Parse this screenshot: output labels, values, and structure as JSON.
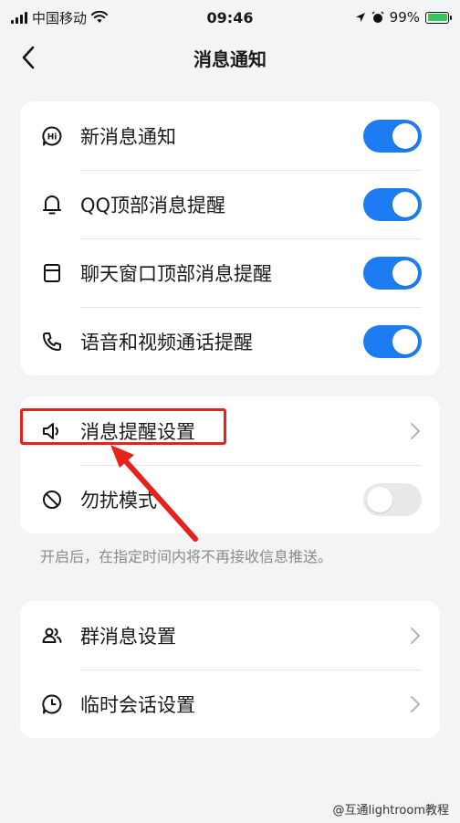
{
  "status_bar": {
    "carrier": "中国移动",
    "time": "09:46",
    "battery": "99%"
  },
  "nav": {
    "title": "消息通知"
  },
  "notification_card": {
    "items": [
      {
        "label": "新消息通知",
        "icon": "hi-bubble-icon",
        "toggle": true
      },
      {
        "label": "QQ顶部消息提醒",
        "icon": "bell-icon",
        "toggle": true
      },
      {
        "label": "聊天窗口顶部消息提醒",
        "icon": "window-icon",
        "toggle": true
      },
      {
        "label": "语音和视频通话提醒",
        "icon": "phone-icon",
        "toggle": true
      }
    ]
  },
  "reminder_card": {
    "sound_label": "消息提醒设置",
    "dnd_label": "勿扰模式",
    "dnd_toggle": false
  },
  "hint_text": "开启后，在指定时间内将不再接收信息推送。",
  "group_card": {
    "items": [
      {
        "label": "群消息设置",
        "icon": "group-icon"
      },
      {
        "label": "临时会话设置",
        "icon": "clock-bubble-icon"
      }
    ]
  },
  "watermark": "@互通lightroom教程",
  "colors": {
    "accent": "#1e7cf2",
    "highlight": "#e5221b",
    "background": "#f3f4f6"
  }
}
